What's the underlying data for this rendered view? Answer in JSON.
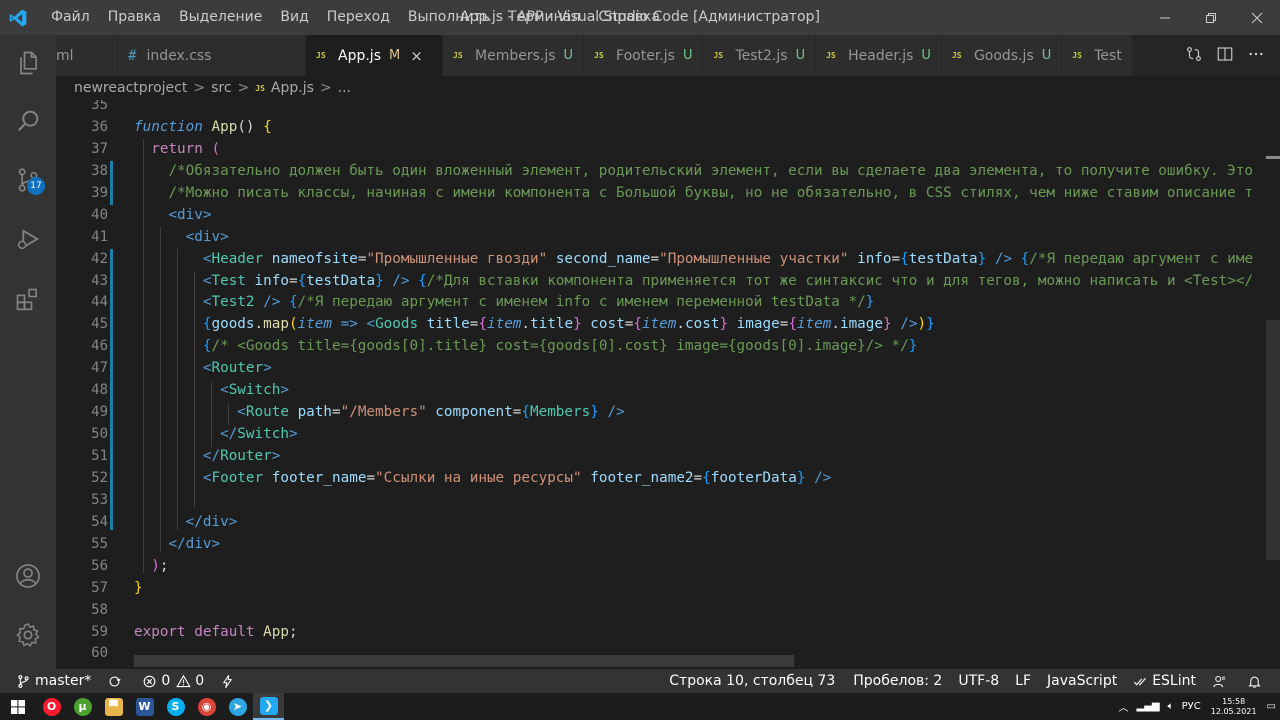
{
  "titlebar": {
    "menu": [
      "Файл",
      "Правка",
      "Выделение",
      "Вид",
      "Переход",
      "Выполнить",
      "Терминал",
      "Справка"
    ],
    "window_title": "App.js - APP - Visual Studio Code [Администратор]"
  },
  "activity": {
    "scm_badge": "17",
    "icons": [
      "explorer-icon",
      "search-icon",
      "source-control-icon",
      "run-debug-icon",
      "extensions-icon",
      "account-icon",
      "settings-gear-icon"
    ]
  },
  "tabs": [
    {
      "label": "ml",
      "status": "",
      "icon": ""
    },
    {
      "label": "index.css",
      "status": "",
      "icon": "css"
    },
    {
      "label": "App.js",
      "status": "M",
      "icon": "JS",
      "active": true
    },
    {
      "label": "Members.js",
      "status": "U",
      "icon": "JS"
    },
    {
      "label": "Footer.js",
      "status": "U",
      "icon": "JS"
    },
    {
      "label": "Test2.js",
      "status": "U",
      "icon": "JS"
    },
    {
      "label": "Header.js",
      "status": "U",
      "icon": "JS"
    },
    {
      "label": "Goods.js",
      "status": "U",
      "icon": "JS"
    },
    {
      "label": "Test",
      "status": "",
      "icon": "JS"
    }
  ],
  "tab_close": "×",
  "breadcrumb": {
    "parts": [
      "newreactproject",
      "src",
      "App.js",
      "..."
    ],
    "sep": ">"
  },
  "editor": {
    "line_numbers": [
      "35",
      "36",
      "37",
      "38",
      "39",
      "40",
      "41",
      "42",
      "43",
      "44",
      "45",
      "46",
      "47",
      "48",
      "49",
      "50",
      "51",
      "52",
      "53",
      "54",
      "55",
      "56",
      "57",
      "58",
      "59",
      "60"
    ],
    "lines": [
      [],
      [
        {
          "t": "function",
          "c": "kb"
        },
        {
          "t": " "
        },
        {
          "t": "App",
          "c": "fn"
        },
        {
          "t": "() "
        },
        {
          "t": "{",
          "c": "br1"
        }
      ],
      [
        {
          "t": "  "
        },
        {
          "t": "return",
          "c": "kw"
        },
        {
          "t": " "
        },
        {
          "t": "(",
          "c": "br2"
        }
      ],
      [
        {
          "t": "    "
        },
        {
          "t": "/*Обязательно должен быть один вложенный элемент, родительский элемент, если вы сделаете два элемента, то получите ошибку. Это",
          "c": "cm"
        }
      ],
      [
        {
          "t": "    "
        },
        {
          "t": "/*Можно писать классы, начиная с имени компонента с Большой буквы, но не обязательно, в CSS стилях, чем ниже ставим описание т",
          "c": "cm"
        }
      ],
      [
        {
          "t": "    "
        },
        {
          "t": "<",
          "c": "tag"
        },
        {
          "t": "div",
          "c": "tag"
        },
        {
          "t": ">",
          "c": "tag"
        }
      ],
      [
        {
          "t": "      "
        },
        {
          "t": "<",
          "c": "tag"
        },
        {
          "t": "div",
          "c": "tag"
        },
        {
          "t": ">",
          "c": "tag"
        }
      ],
      [
        {
          "t": "        "
        },
        {
          "t": "<",
          "c": "tag"
        },
        {
          "t": "Header",
          "c": "comp"
        },
        {
          "t": " "
        },
        {
          "t": "nameofsite",
          "c": "at"
        },
        {
          "t": "="
        },
        {
          "t": "\"Промышленные гвозди\"",
          "c": "str"
        },
        {
          "t": " "
        },
        {
          "t": "second_name",
          "c": "at"
        },
        {
          "t": "="
        },
        {
          "t": "\"Промышленные участки\"",
          "c": "str"
        },
        {
          "t": " "
        },
        {
          "t": "info",
          "c": "at"
        },
        {
          "t": "="
        },
        {
          "t": "{",
          "c": "br3"
        },
        {
          "t": "testData",
          "c": "var"
        },
        {
          "t": "}",
          "c": "br3"
        },
        {
          "t": " "
        },
        {
          "t": "/>",
          "c": "tag"
        },
        {
          "t": " "
        },
        {
          "t": "{",
          "c": "br3"
        },
        {
          "t": "/*Я передаю аргумент с име",
          "c": "cm"
        }
      ],
      [
        {
          "t": "        "
        },
        {
          "t": "<",
          "c": "tag"
        },
        {
          "t": "Test",
          "c": "comp"
        },
        {
          "t": " "
        },
        {
          "t": "info",
          "c": "at"
        },
        {
          "t": "="
        },
        {
          "t": "{",
          "c": "br3"
        },
        {
          "t": "testData",
          "c": "var"
        },
        {
          "t": "}",
          "c": "br3"
        },
        {
          "t": " "
        },
        {
          "t": "/>",
          "c": "tag"
        },
        {
          "t": " "
        },
        {
          "t": "{",
          "c": "br3"
        },
        {
          "t": "/*Для вставки компонента применяется тот же синтаксис что и для тегов, можно написать и <Test></",
          "c": "cm"
        }
      ],
      [
        {
          "t": "        "
        },
        {
          "t": "<",
          "c": "tag"
        },
        {
          "t": "Test2",
          "c": "comp"
        },
        {
          "t": " "
        },
        {
          "t": "/>",
          "c": "tag"
        },
        {
          "t": " "
        },
        {
          "t": "{",
          "c": "br3"
        },
        {
          "t": "/*Я передаю аргумент с именем info с именем переменной testData */",
          "c": "cm"
        },
        {
          "t": "}",
          "c": "br3"
        }
      ],
      [
        {
          "t": "        "
        },
        {
          "t": "{",
          "c": "br3"
        },
        {
          "t": "goods",
          "c": "var"
        },
        {
          "t": "."
        },
        {
          "t": "map",
          "c": "fn"
        },
        {
          "t": "(",
          "c": "br1"
        },
        {
          "t": "item",
          "c": "kb"
        },
        {
          "t": " "
        },
        {
          "t": "=>",
          "c": "tag"
        },
        {
          "t": " "
        },
        {
          "t": "<",
          "c": "tag"
        },
        {
          "t": "Goods",
          "c": "comp"
        },
        {
          "t": " "
        },
        {
          "t": "title",
          "c": "at"
        },
        {
          "t": "="
        },
        {
          "t": "{",
          "c": "br2"
        },
        {
          "t": "item",
          "c": "kb"
        },
        {
          "t": "."
        },
        {
          "t": "title",
          "c": "var"
        },
        {
          "t": "}",
          "c": "br2"
        },
        {
          "t": " "
        },
        {
          "t": "cost",
          "c": "at"
        },
        {
          "t": "="
        },
        {
          "t": "{",
          "c": "br2"
        },
        {
          "t": "item",
          "c": "kb"
        },
        {
          "t": "."
        },
        {
          "t": "cost",
          "c": "var"
        },
        {
          "t": "}",
          "c": "br2"
        },
        {
          "t": " "
        },
        {
          "t": "image",
          "c": "at"
        },
        {
          "t": "="
        },
        {
          "t": "{",
          "c": "br2"
        },
        {
          "t": "item",
          "c": "kb"
        },
        {
          "t": "."
        },
        {
          "t": "image",
          "c": "var"
        },
        {
          "t": "}",
          "c": "br2"
        },
        {
          "t": " "
        },
        {
          "t": "/>",
          "c": "tag"
        },
        {
          "t": ")",
          "c": "br1"
        },
        {
          "t": "}",
          "c": "br3"
        }
      ],
      [
        {
          "t": "        "
        },
        {
          "t": "{",
          "c": "br3"
        },
        {
          "t": "/* <Goods title={goods[0].title} cost={goods[0].cost} image={goods[0].image}/> */",
          "c": "cm"
        },
        {
          "t": "}",
          "c": "br3"
        }
      ],
      [
        {
          "t": "        "
        },
        {
          "t": "<",
          "c": "tag"
        },
        {
          "t": "Router",
          "c": "comp"
        },
        {
          "t": ">",
          "c": "tag"
        }
      ],
      [
        {
          "t": "          "
        },
        {
          "t": "<",
          "c": "tag"
        },
        {
          "t": "Switch",
          "c": "comp"
        },
        {
          "t": ">",
          "c": "tag"
        }
      ],
      [
        {
          "t": "            "
        },
        {
          "t": "<",
          "c": "tag"
        },
        {
          "t": "Route",
          "c": "comp"
        },
        {
          "t": " "
        },
        {
          "t": "path",
          "c": "at"
        },
        {
          "t": "="
        },
        {
          "t": "\"/Members\"",
          "c": "str"
        },
        {
          "t": " "
        },
        {
          "t": "component",
          "c": "at"
        },
        {
          "t": "="
        },
        {
          "t": "{",
          "c": "br3"
        },
        {
          "t": "Members",
          "c": "comp"
        },
        {
          "t": "}",
          "c": "br3"
        },
        {
          "t": " "
        },
        {
          "t": "/>",
          "c": "tag"
        }
      ],
      [
        {
          "t": "          "
        },
        {
          "t": "</",
          "c": "tag"
        },
        {
          "t": "Switch",
          "c": "comp"
        },
        {
          "t": ">",
          "c": "tag"
        }
      ],
      [
        {
          "t": "        "
        },
        {
          "t": "</",
          "c": "tag"
        },
        {
          "t": "Router",
          "c": "comp"
        },
        {
          "t": ">",
          "c": "tag"
        }
      ],
      [
        {
          "t": "        "
        },
        {
          "t": "<",
          "c": "tag"
        },
        {
          "t": "Footer",
          "c": "comp"
        },
        {
          "t": " "
        },
        {
          "t": "footer_name",
          "c": "at"
        },
        {
          "t": "="
        },
        {
          "t": "\"Ссылки на иные ресурсы\"",
          "c": "str"
        },
        {
          "t": " "
        },
        {
          "t": "footer_name2",
          "c": "at"
        },
        {
          "t": "="
        },
        {
          "t": "{",
          "c": "br3"
        },
        {
          "t": "footerData",
          "c": "var"
        },
        {
          "t": "}",
          "c": "br3"
        },
        {
          "t": " "
        },
        {
          "t": "/>",
          "c": "tag"
        }
      ],
      [],
      [
        {
          "t": "      "
        },
        {
          "t": "</",
          "c": "tag"
        },
        {
          "t": "div",
          "c": "tag"
        },
        {
          "t": ">",
          "c": "tag"
        }
      ],
      [
        {
          "t": "    "
        },
        {
          "t": "</",
          "c": "tag"
        },
        {
          "t": "div",
          "c": "tag"
        },
        {
          "t": ">",
          "c": "tag"
        }
      ],
      [
        {
          "t": "  "
        },
        {
          "t": ")",
          "c": "br2"
        },
        {
          "t": ";"
        }
      ],
      [
        {
          "t": "}",
          "c": "br1"
        }
      ],
      [],
      [
        {
          "t": "export",
          "c": "kw"
        },
        {
          "t": " "
        },
        {
          "t": "default",
          "c": "kw"
        },
        {
          "t": " "
        },
        {
          "t": "App",
          "c": "fn"
        },
        {
          "t": ";"
        }
      ],
      []
    ]
  },
  "statusbar": {
    "branch": "master*",
    "errors": "0",
    "warnings": "0",
    "position": "Строка 10, столбец 73",
    "spaces": "Пробелов: 2",
    "encoding": "UTF-8",
    "eol": "LF",
    "language": "JavaScript",
    "linter": "ESLint"
  },
  "taskbar": {
    "apps": [
      {
        "name": "opera",
        "color": "#ff1b2d",
        "glyph": "O"
      },
      {
        "name": "utorrent",
        "color": "#4ba02f",
        "glyph": "µ"
      },
      {
        "name": "file-explorer",
        "color": "#e8b54a",
        "glyph": "▀"
      },
      {
        "name": "word",
        "color": "#2b579a",
        "glyph": "W"
      },
      {
        "name": "skype",
        "color": "#00aff0",
        "glyph": "S"
      },
      {
        "name": "chrome",
        "color": "#db4437",
        "glyph": "◉"
      },
      {
        "name": "telegram",
        "color": "#2ca5e0",
        "glyph": "➤"
      },
      {
        "name": "vscode",
        "color": "#23a9f2",
        "glyph": "❯",
        "active": true
      }
    ],
    "lang": "РУС",
    "time": "15:58",
    "date": "12.05.2021"
  }
}
